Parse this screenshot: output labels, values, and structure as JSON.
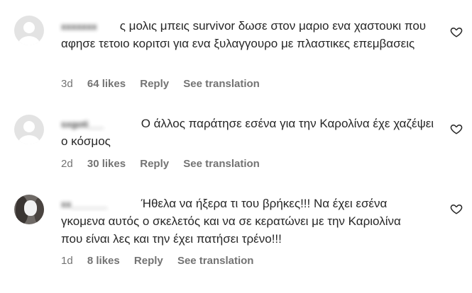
{
  "comments": [
    {
      "username": "xxxxxxx",
      "text": "ς μολις μπεις survivor δωσε στον μαριο ενα χαστουκι που αφησε τετοιο κοριτσι για ενα ξυλαγγουρο με πλαστικες επεμβασεις",
      "time": "3d",
      "likes": "64 likes",
      "reply": "Reply",
      "see_translation": "See translation",
      "avatar": "default-avatar-icon",
      "heart": "heart-outline-icon"
    },
    {
      "username": "sxgoti___",
      "text": "Ο άλλος παράτησε εσένα για την Καρολίνα έχε χαζέψει ο κόσμος",
      "time": "2d",
      "likes": "30 likes",
      "reply": "Reply",
      "see_translation": "See translation",
      "avatar": "default-avatar-icon",
      "heart": "heart-outline-icon"
    },
    {
      "username": "xx_______",
      "text": "Ήθελα να ήξερα τι του βρήκες!!! Να έχει εσένα γκομενα αυτός ο σκελετός και να σε κερατώνει με την Καριολίνα που είναι λες και την έχει πατήσει τρένο!!!",
      "time": "1d",
      "likes": "8 likes",
      "reply": "Reply",
      "see_translation": "See translation",
      "avatar": "profile-photo-avatar",
      "heart": "heart-outline-icon"
    }
  ],
  "colors": {
    "text": "#262626",
    "meta": "#737373",
    "avatar_bg": "#e3e3e3"
  }
}
